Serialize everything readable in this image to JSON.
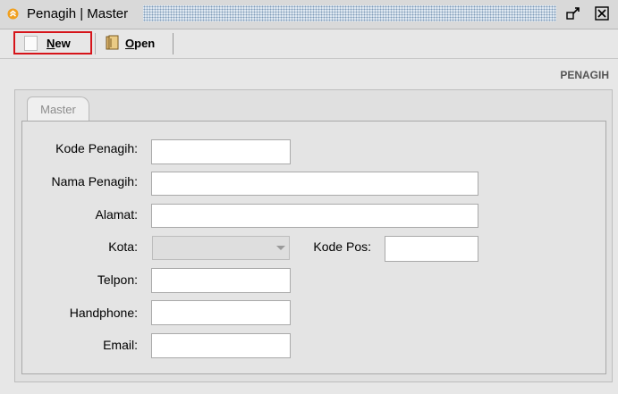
{
  "window": {
    "title": "Penagih | Master",
    "icons": {
      "app": "app-icon",
      "restore": "restore-icon",
      "close": "close-icon"
    }
  },
  "toolbar": {
    "new_first": "N",
    "new_rest": "ew",
    "open_first": "O",
    "open_rest": "pen",
    "new_icon": "blank-document-icon",
    "open_icon": "open-folder-icon"
  },
  "section_title": "PENAGIH",
  "tabs": [
    {
      "label": "Master",
      "selected": true
    }
  ],
  "form": {
    "kode_label": "Kode Penagih:",
    "kode_value": "",
    "nama_label": "Nama Penagih:",
    "nama_value": "",
    "alamat_label": "Alamat:",
    "alamat_value": "",
    "kota_label": "Kota:",
    "kota_value": "",
    "kodepos_label": "Kode Pos:",
    "kodepos_value": "",
    "telpon_label": "Telpon:",
    "telpon_value": "",
    "handphone_label": "Handphone:",
    "handphone_value": "",
    "email_label": "Email:",
    "email_value": ""
  },
  "colors": {
    "highlight_border": "#d6141a",
    "app_icon": "#f0a020",
    "title_pattern": "#7f9bb9"
  }
}
